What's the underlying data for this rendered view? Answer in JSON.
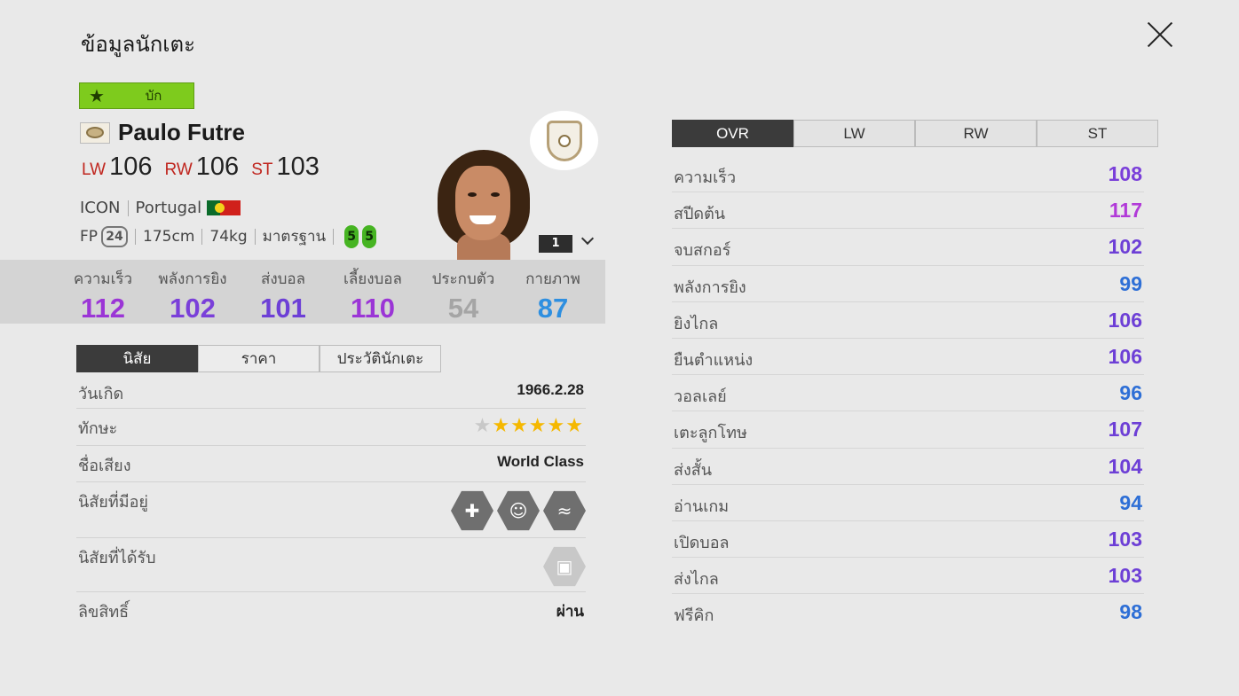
{
  "page_title": "ข้อมูลนักเตะ",
  "grade_badge": {
    "label": "บัก",
    "star": "★"
  },
  "player": {
    "name": "Paulo Futre",
    "positions": [
      {
        "code": "LW",
        "value": "106"
      },
      {
        "code": "RW",
        "value": "106"
      },
      {
        "code": "ST",
        "value": "103"
      }
    ],
    "card_type": "ICON",
    "nation": "Portugal",
    "fp_label": "FP",
    "fp_value": "24",
    "height": "175cm",
    "weight": "74kg",
    "body_type": "มาตรฐาน",
    "left_foot": "5",
    "right_foot": "5",
    "enhancement_level": "1"
  },
  "summary": [
    {
      "label": "ความเร็ว",
      "value": "112",
      "color": "#9b35d6"
    },
    {
      "label": "พลังการยิง",
      "value": "102",
      "color": "#7a3fd9"
    },
    {
      "label": "ส่งบอล",
      "value": "101",
      "color": "#6d3fd6"
    },
    {
      "label": "เลี้ยงบอล",
      "value": "110",
      "color": "#9b35d6"
    },
    {
      "label": "ประกบตัว",
      "value": "54",
      "color": "#a5a5a5"
    },
    {
      "label": "กายภาพ",
      "value": "87",
      "color": "#2e8fe0"
    }
  ],
  "left_tabs": [
    "นิสัย",
    "ราคา",
    "ประวัตินักเตะ"
  ],
  "info": {
    "birth_label": "วันเกิด",
    "birth_value": "1966.2.28",
    "skill_label": "ทักษะ",
    "skill_stars": 5,
    "skill_max": 6,
    "reputation_label": "ชื่อเสียง",
    "reputation_value": "World Class",
    "traits_label": "นิสัยที่มีอยู่",
    "traits": [
      "injury-prone-icon",
      "flair-icon",
      "dribbling-icon"
    ],
    "gained_traits_label": "นิสัยที่ได้รับ",
    "license_label": "ลิขสิทธิ์",
    "license_value": "ผ่าน"
  },
  "right_tabs": [
    "OVR",
    "LW",
    "RW",
    "ST"
  ],
  "attributes": [
    {
      "name": "ความเร็ว",
      "value": "108",
      "color": "#7a3fd9"
    },
    {
      "name": "สปีดต้น",
      "value": "117",
      "color": "#b13ad8"
    },
    {
      "name": "จบสกอร์",
      "value": "102",
      "color": "#6d3fd6"
    },
    {
      "name": "พลังการยิง",
      "value": "99",
      "color": "#2e6fd6"
    },
    {
      "name": "ยิงไกล",
      "value": "106",
      "color": "#6d3fd6"
    },
    {
      "name": "ยืนตำแหน่ง",
      "value": "106",
      "color": "#6d3fd6"
    },
    {
      "name": "วอลเลย์",
      "value": "96",
      "color": "#2e6fd6"
    },
    {
      "name": "เตะลูกโทษ",
      "value": "107",
      "color": "#6d3fd6"
    },
    {
      "name": "ส่งสั้น",
      "value": "104",
      "color": "#6d3fd6"
    },
    {
      "name": "อ่านเกม",
      "value": "94",
      "color": "#2e6fd6"
    },
    {
      "name": "เปิดบอล",
      "value": "103",
      "color": "#6d3fd6"
    },
    {
      "name": "ส่งไกล",
      "value": "103",
      "color": "#6d3fd6"
    },
    {
      "name": "ฟรีคิก",
      "value": "98",
      "color": "#2e6fd6"
    }
  ]
}
